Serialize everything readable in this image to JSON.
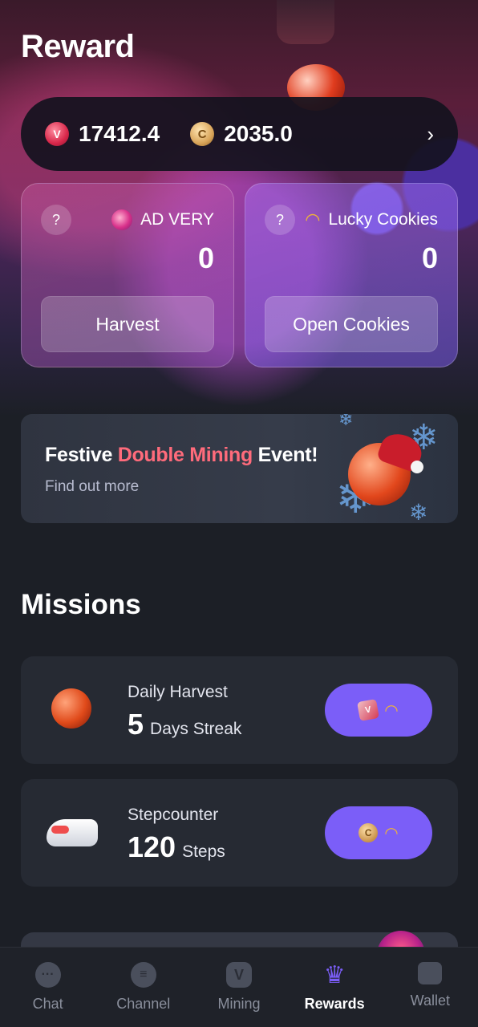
{
  "header": {
    "title": "Reward"
  },
  "balance": {
    "v_icon": "V",
    "v_amount": "17412.4",
    "c_icon": "C",
    "c_amount": "2035.0",
    "chevron": "›"
  },
  "cards": [
    {
      "help": "?",
      "label": "AD VERY",
      "count": "0",
      "button": "Harvest",
      "icon": "raspberry-icon"
    },
    {
      "help": "?",
      "label": "Lucky Cookies",
      "count": "0",
      "button": "Open Cookies",
      "icon": "fortune-cookie-icon"
    }
  ],
  "banner": {
    "title_pre": "Festive ",
    "title_highlight": "Double Mining",
    "title_post": " Event!",
    "subtitle": "Find out more"
  },
  "missions": {
    "title": "Missions",
    "items": [
      {
        "name": "Daily Harvest",
        "value": "5",
        "unit": "Days Streak",
        "reward_icons": [
          "v-ticket-icon",
          "fortune-cookie-icon"
        ]
      },
      {
        "name": "Stepcounter",
        "value": "120",
        "unit": "Steps",
        "reward_icons": [
          "coin-icon",
          "fortune-cookie-icon"
        ]
      }
    ]
  },
  "tabbar": {
    "items": [
      {
        "label": "Chat",
        "icon": "chat-bubble-icon",
        "active": false
      },
      {
        "label": "Channel",
        "icon": "channel-icon",
        "active": false
      },
      {
        "label": "Mining",
        "icon": "mining-badge-icon",
        "active": false
      },
      {
        "label": "Rewards",
        "icon": "crown-icon",
        "active": true
      },
      {
        "label": "Wallet",
        "icon": "wallet-icon",
        "active": false
      }
    ]
  },
  "colors": {
    "accent": "#7b5ef8",
    "highlight": "#ff6b7b",
    "background": "#1c1f26"
  }
}
